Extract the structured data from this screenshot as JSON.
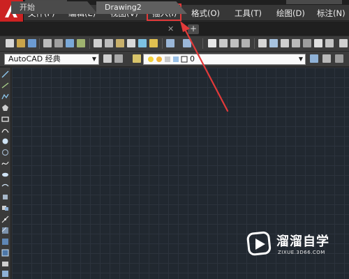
{
  "menu": {
    "items": [
      "文件(F)",
      "编辑(E)",
      "视图(V)",
      "插入(I)",
      "格式(O)",
      "工具(T)",
      "绘图(D)",
      "标注(N)"
    ],
    "highlighted": "插入(I)"
  },
  "tabs": {
    "start_label": "开始",
    "drawing_label": "Drawing2",
    "close_glyph": "✕",
    "add_glyph": "+"
  },
  "toolbar": {
    "workspace_value": "AutoCAD 经典",
    "layer_value": "0"
  },
  "watermark": {
    "brand": "溜溜自学",
    "url": "ZIXUE.3D66.COM"
  },
  "colors": {
    "highlight": "#e23a3a",
    "canvas": "#212830",
    "logo": "#cc2222"
  },
  "icons": {
    "app_logo": "autocad-logo-icon",
    "watermark_logo": "play-logo-icon"
  }
}
